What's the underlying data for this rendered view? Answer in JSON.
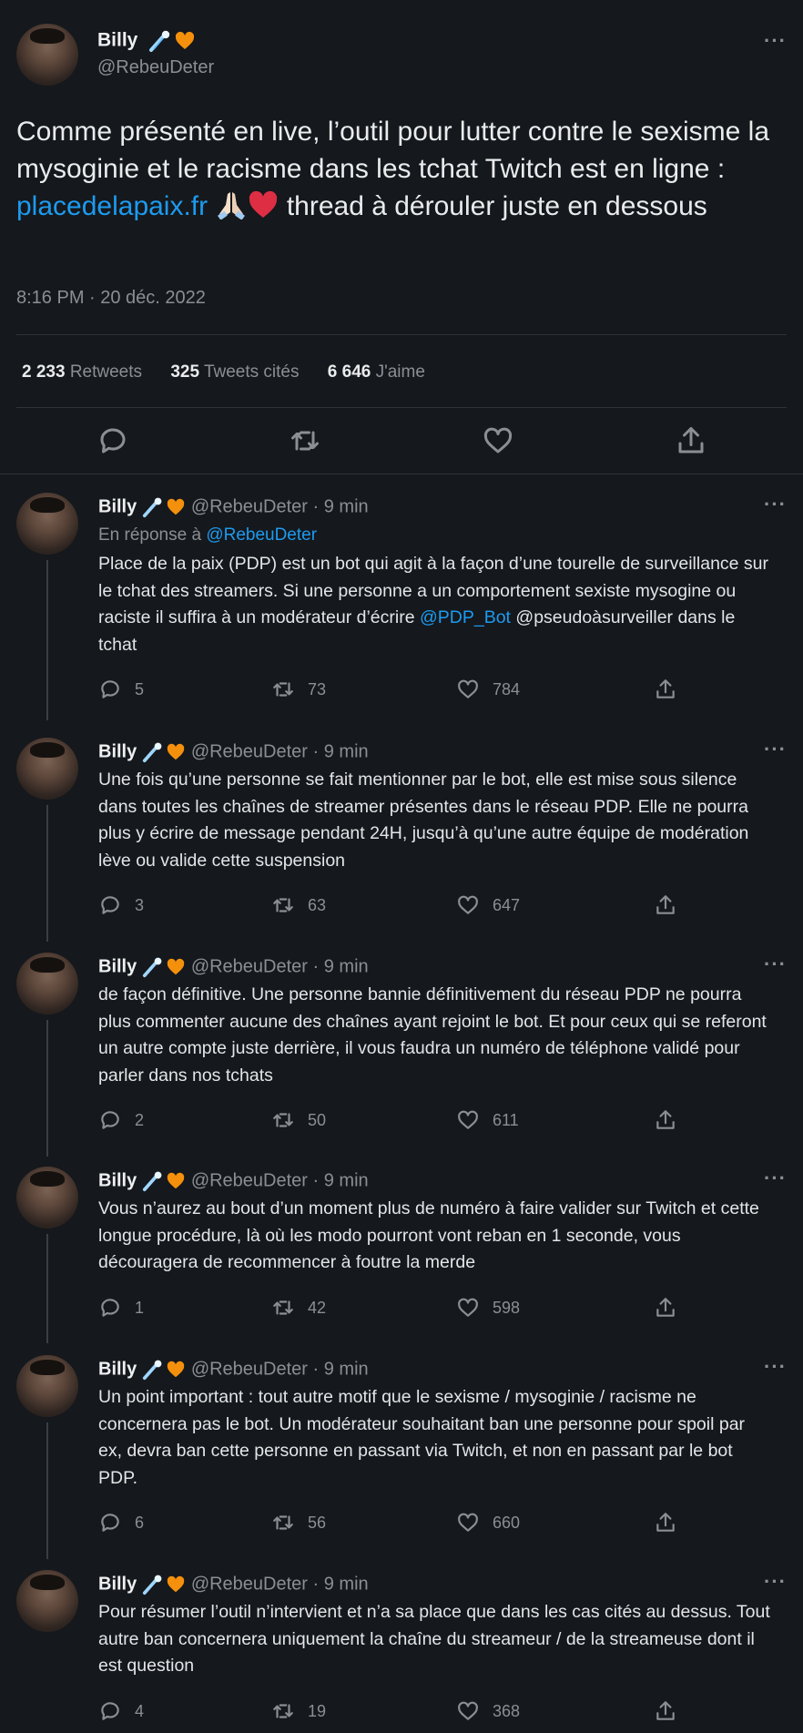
{
  "main_tweet": {
    "author_name": "Billy",
    "handle": "@RebeuDeter",
    "text_before_link": "Comme présenté en live, l’outil pour lutter contre le sexisme la mysoginie et le racisme dans les tchat Twitch est en ligne : ",
    "link": "placedelapaix.fr",
    "text_after_link": " thread à dérouler juste en dessous",
    "timestamp": "8:16 PM · 20 déc. 2022",
    "retweets_count": "2 233",
    "retweets_label": "Retweets",
    "quotes_count": "325",
    "quotes_label": "Tweets cités",
    "likes_count": "6 646",
    "likes_label": "J'aime",
    "more": "···"
  },
  "replies": [
    {
      "author_name": "Billy",
      "handle": "@RebeuDeter",
      "time": "· 9 min",
      "in_reply_prefix": "En réponse à ",
      "in_reply_handle": "@RebeuDeter",
      "text_a": "Place de la paix (PDP) est un bot qui agit à la façon d’une tourelle de surveillance sur le tchat des streamers. Si une personne a un comportement sexiste mysogine ou raciste il suffira à un modérateur d’écrire ",
      "mention": "@PDP_Bot",
      "text_b": " @pseudoàsurveiller dans le tchat",
      "replies": "5",
      "retweets": "73",
      "likes": "784"
    },
    {
      "author_name": "Billy",
      "handle": "@RebeuDeter",
      "time": "· 9 min",
      "text_a": "Une fois qu’une personne se fait mentionner par le bot, elle est mise sous silence dans toutes les chaînes de streamer présentes dans le réseau PDP. Elle ne pourra plus y écrire de message pendant 24H, jusqu’à qu’une autre équipe de modération lève ou valide cette suspension",
      "replies": "3",
      "retweets": "63",
      "likes": "647"
    },
    {
      "author_name": "Billy",
      "handle": "@RebeuDeter",
      "time": "· 9 min",
      "text_a": "de façon définitive. Une personne bannie définitivement du réseau PDP ne pourra plus commenter aucune des chaînes ayant rejoint le bot. Et pour ceux qui se referont un autre compte juste derrière, il vous faudra un numéro de téléphone validé pour parler dans nos tchats",
      "replies": "2",
      "retweets": "50",
      "likes": "611"
    },
    {
      "author_name": "Billy",
      "handle": "@RebeuDeter",
      "time": "· 9 min",
      "text_a": "Vous n’aurez au bout d’un moment plus de numéro à faire valider sur Twitch et cette longue procédure, là où les modo pourront vont reban en 1 seconde, vous découragera de recommencer à foutre la merde",
      "replies": "1",
      "retweets": "42",
      "likes": "598"
    },
    {
      "author_name": "Billy",
      "handle": "@RebeuDeter",
      "time": "· 9 min",
      "text_a": "Un point important : tout autre motif que le sexisme / mysoginie / racisme ne concernera pas le bot. Un modérateur souhaitant ban une personne pour spoil par ex, devra ban cette personne en passant via Twitch, et non en passant par le bot PDP.",
      "replies": "6",
      "retweets": "56",
      "likes": "660"
    },
    {
      "author_name": "Billy",
      "handle": "@RebeuDeter",
      "time": "· 9 min",
      "text_a": "Pour résumer l’outil n’intervient et n’a sa place que dans les cas cités au dessus. Tout autre ban concernera uniquement la chaîne du streameur / de la streameuse dont il est question",
      "replies": "4",
      "retweets": "19",
      "likes": "368"
    }
  ],
  "icons": [
    "comet-emoji-icon",
    "orange-heart-icon",
    "praying-hands-icon",
    "red-heart-icon",
    "reply-icon",
    "retweet-icon",
    "like-icon",
    "share-icon",
    "more-icon"
  ],
  "colors": {
    "background": "#15181c",
    "accent": "#1d9bf0",
    "muted": "#8b8f94",
    "text": "#e3e5e7"
  }
}
